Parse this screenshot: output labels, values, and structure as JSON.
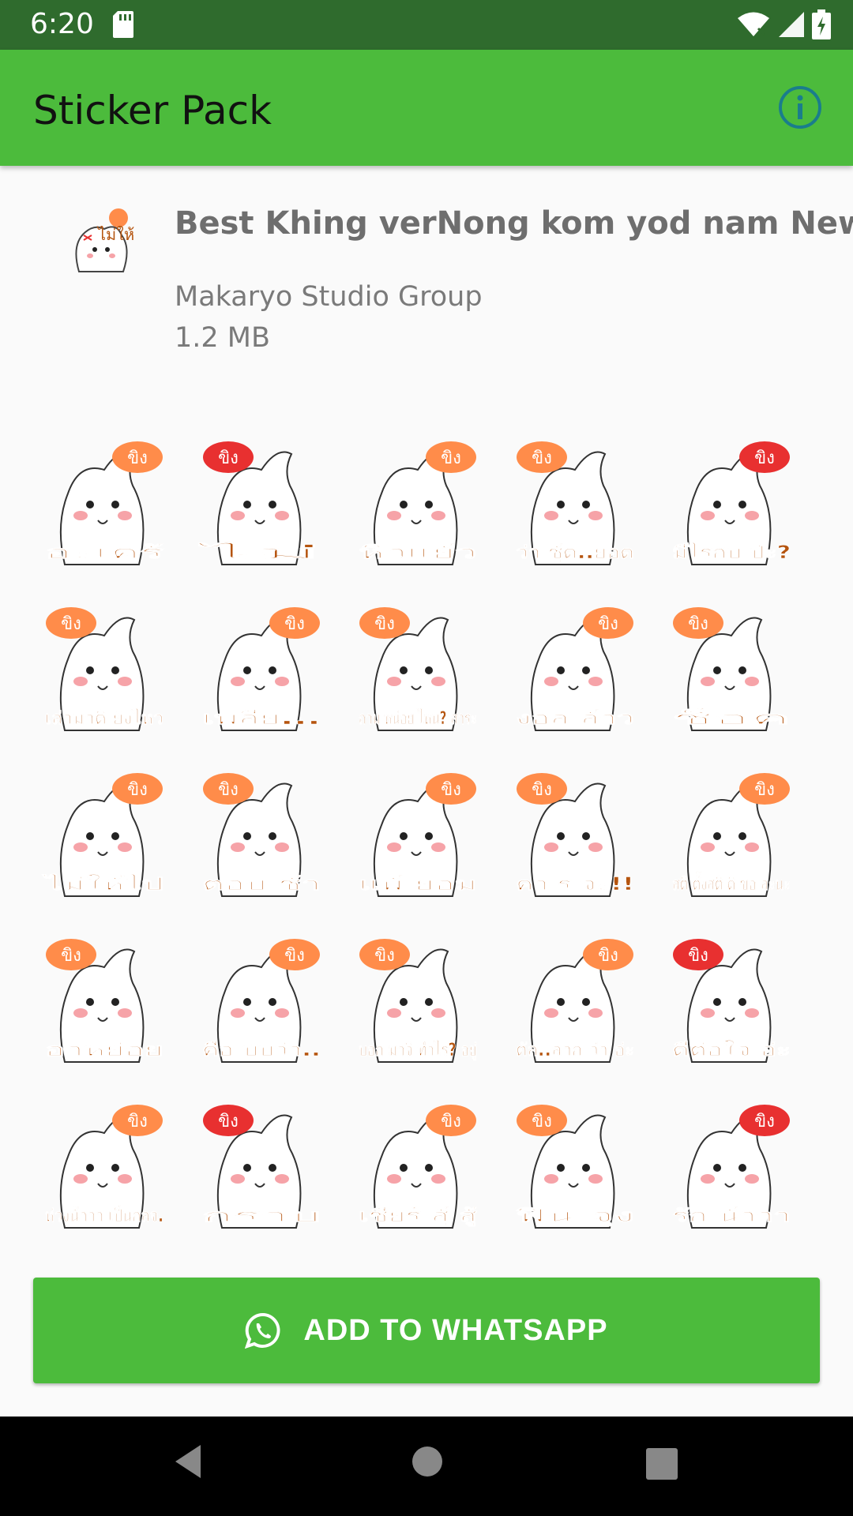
{
  "status": {
    "time": "6:20"
  },
  "appbar": {
    "title": "Sticker Pack"
  },
  "pack": {
    "name": "Best Khing verNong kom yod nam New",
    "publisher": "Makaryo Studio Group",
    "size": "1.2 MB",
    "tray_text": "ไม่ให้"
  },
  "stickers": [
    {
      "badge": "ขิง",
      "text": "อะเคร้",
      "accent": "#ff8c4a"
    },
    {
      "badge": "ขิง",
      "text": "ไม่",
      "accent": "#e83030"
    },
    {
      "badge": "ขิง",
      "text": "หิวแย้ว",
      "accent": "#ff8c4a"
    },
    {
      "badge": "ขิง",
      "text": "ว่า ชู้ด..ยอด",
      "accent": "#ff8c4a"
    },
    {
      "badge": "ขิง",
      "text": "มีไรกับ ป่ะ?",
      "accent": "#e83030"
    },
    {
      "badge": "ขิง",
      "text": "เล่ามาดิ ยังไหว",
      "accent": "#ff8c4a"
    },
    {
      "badge": "ขิง",
      "text": "เพลีย...",
      "accent": "#ff8c4a"
    },
    {
      "badge": "ขิง",
      "text": "ถาม หน่อย ไหน? สาระ",
      "accent": "#ff8c4a"
    },
    {
      "badge": "ขิง",
      "text": "งอล ล้าว",
      "accent": "#ff8c4a"
    },
    {
      "badge": "ขิง",
      "text": "ช็อค",
      "accent": "#ff8c4a"
    },
    {
      "badge": "ขิง",
      "text": "ไม่ให้ไป",
      "accent": "#ff8c4a"
    },
    {
      "badge": "ขิง",
      "text": "ตอบ ช้า",
      "accent": "#ff8c4a"
    },
    {
      "badge": "ขิง",
      "text": "แพ้ ยอม",
      "accent": "#ff8c4a"
    },
    {
      "badge": "ขิง",
      "text": "คา ร จะ!!",
      "accent": "#ff8c4a"
    },
    {
      "badge": "ขิง",
      "text": "สติ ตั้งสติ ดิ ขอ ละนะ",
      "accent": "#ff8c4a"
    },
    {
      "badge": "ขิง",
      "text": "อาหย่อย",
      "accent": "#ff8c4a"
    },
    {
      "badge": "ขิง",
      "text": "คือ บับว่า..",
      "accent": "#ff8c4a"
    },
    {
      "badge": "ขิง",
      "text": "บอก มาจิ ทำไร? อยู่",
      "accent": "#ff8c4a"
    },
    {
      "badge": "ขิง",
      "text": "ตัล..ลาก ว่า อ่ะ",
      "accent": "#ff8c4a"
    },
    {
      "badge": "ขิง",
      "text": "ดีต่อใจ อ่ะ",
      "accent": "#e83030"
    },
    {
      "badge": "ขิง",
      "text": "ห่วงน้าาา เป็นกลจ.",
      "accent": "#ff8c4a"
    },
    {
      "badge": "ขิง",
      "text": "กราบ",
      "accent": "#e83030"
    },
    {
      "badge": "ขิง",
      "text": "เชียร์ สู้ สู้",
      "accent": "#ff8c4a"
    },
    {
      "badge": "ขิง",
      "text": "ฟิน จุง",
      "accent": "#ff8c4a"
    },
    {
      "badge": "ขิง",
      "text": "รัก น้าาา",
      "accent": "#e83030"
    }
  ],
  "add_button": {
    "label": "ADD TO WHATSAPP"
  }
}
